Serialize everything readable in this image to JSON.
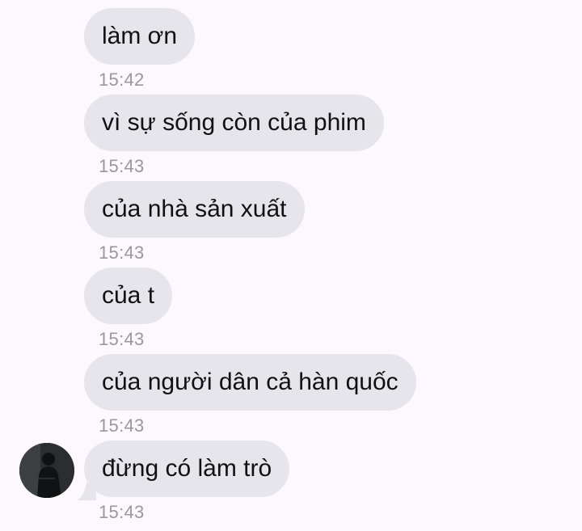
{
  "conversation": {
    "messages": [
      {
        "text": "làm ơn",
        "time": "15:42"
      },
      {
        "text": "vì sự sống còn của phim",
        "time": "15:43"
      },
      {
        "text": "của nhà sản xuất",
        "time": "15:43"
      },
      {
        "text": "của t",
        "time": "15:43"
      },
      {
        "text": "của người dân cả hàn quốc",
        "time": "15:43"
      },
      {
        "text": "đừng có làm trò",
        "time": "15:43",
        "avatar": "contact-avatar"
      }
    ]
  },
  "colors": {
    "background": "#fcf8fd",
    "bubble": "#e6e5eb",
    "timestamp": "#9a979e",
    "text": "#111111"
  }
}
